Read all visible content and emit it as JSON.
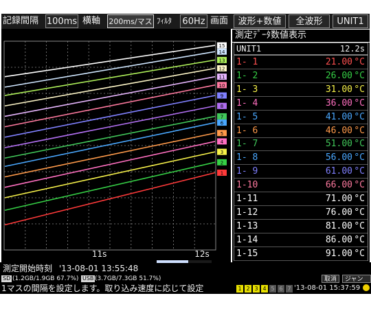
{
  "toolbar": {
    "rec_interval_label": "記録間隔",
    "rec_interval_value": "100ms",
    "horizontal_label": "横軸",
    "horizontal_value": "200ms/マス",
    "filter_label": "ﾌｨﾙﾀ",
    "filter_value": "60Hz",
    "screen_label": "画面",
    "screen_value": "波形+数値",
    "waveform_value": "全波形",
    "unit_value": "UNIT1"
  },
  "graph": {
    "x_ticks": [
      "11s",
      "12s"
    ],
    "channel_markers": [
      "15",
      "14",
      "13",
      "12",
      "11",
      "10",
      "9",
      "8",
      "7",
      "6",
      "5",
      "4",
      "3",
      "2",
      "1"
    ]
  },
  "chart_data": {
    "type": "line",
    "xlabel": "",
    "ylabel": "",
    "x_ticks": [
      "11s",
      "12s"
    ],
    "series": [
      {
        "name": "15",
        "color": "#ffffff",
        "values": [
          0.83,
          0.98
        ]
      },
      {
        "name": "14",
        "color": "#cfe6ff",
        "values": [
          0.78,
          0.95
        ]
      },
      {
        "name": "13",
        "color": "#aef05a",
        "values": [
          0.74,
          0.91
        ]
      },
      {
        "name": "12",
        "color": "#fff7c8",
        "values": [
          0.69,
          0.87
        ]
      },
      {
        "name": "11",
        "color": "#e8b6ff",
        "values": [
          0.64,
          0.83
        ]
      },
      {
        "name": "10",
        "color": "#ff7aa0",
        "values": [
          0.59,
          0.79
        ]
      },
      {
        "name": "9",
        "color": "#8080ff",
        "values": [
          0.54,
          0.74
        ]
      },
      {
        "name": "8",
        "color": "#b06ef0",
        "values": [
          0.49,
          0.69
        ]
      },
      {
        "name": "7",
        "color": "#41c85a",
        "values": [
          0.44,
          0.64
        ]
      },
      {
        "name": "6",
        "color": "#4aa8ff",
        "values": [
          0.4,
          0.61
        ]
      },
      {
        "name": "5",
        "color": "#ff9a4a",
        "values": [
          0.35,
          0.56
        ]
      },
      {
        "name": "4",
        "color": "#ff6fc0",
        "values": [
          0.3,
          0.52
        ]
      },
      {
        "name": "3",
        "color": "#f7f24a",
        "values": [
          0.25,
          0.47
        ]
      },
      {
        "name": "2",
        "color": "#36d046",
        "values": [
          0.19,
          0.42
        ]
      },
      {
        "name": "1",
        "color": "#ff3a3a",
        "values": [
          0.12,
          0.37
        ]
      }
    ]
  },
  "panel": {
    "title": "測定ﾃﾞｰﾀ数値表示",
    "unit_name": "UNIT1",
    "elapsed": "12.2s",
    "rows": [
      {
        "ch": "1- 1",
        "value": "21.00",
        "unit": "°C",
        "color": "#ff5050"
      },
      {
        "ch": "1- 2",
        "value": "26.00",
        "unit": "°C",
        "color": "#36d046"
      },
      {
        "ch": "1- 3",
        "value": "31.00",
        "unit": "°C",
        "color": "#f7f24a"
      },
      {
        "ch": "1- 4",
        "value": "36.00",
        "unit": "°C",
        "color": "#ff6fc0"
      },
      {
        "ch": "1- 5",
        "value": "41.00",
        "unit": "°C",
        "color": "#4aa8ff"
      },
      {
        "ch": "1- 6",
        "value": "46.00",
        "unit": "°C",
        "color": "#ff9a4a"
      },
      {
        "ch": "1- 7",
        "value": "51.00",
        "unit": "°C",
        "color": "#41c85a"
      },
      {
        "ch": "1- 8",
        "value": "56.00",
        "unit": "°C",
        "color": "#4aa8ff"
      },
      {
        "ch": "1- 9",
        "value": "61.00",
        "unit": "°C",
        "color": "#8080ff"
      },
      {
        "ch": "1-10",
        "value": "66.00",
        "unit": "°C",
        "color": "#ff7aa0"
      },
      {
        "ch": "1-11",
        "value": "71.00",
        "unit": "°C",
        "color": "#ffffff"
      },
      {
        "ch": "1-12",
        "value": "76.00",
        "unit": "°C",
        "color": "#ffffff"
      },
      {
        "ch": "1-13",
        "value": "81.00",
        "unit": "°C",
        "color": "#ffffff"
      },
      {
        "ch": "1-14",
        "value": "86.00",
        "unit": "°C",
        "color": "#ffffff"
      },
      {
        "ch": "1-15",
        "value": "91.00",
        "unit": "°C",
        "color": "#ffffff"
      }
    ]
  },
  "status": {
    "start_label": "測定開始時刻",
    "start_time": "'13-08-01 13:55:48",
    "sd_label": "SD",
    "sd_text": "(1.2GB/1.9GB 67.7%)",
    "usb_label": "USB",
    "usb_text": "(3.7GB/7.3GB 51.7%)",
    "cancel_label": "取消",
    "jump_label": "ジャンプ",
    "help_text": "1マスの間隔を設定します。取り込み速度に応じて設定",
    "indicators": [
      "1",
      "2",
      "3",
      "4",
      "5",
      "6",
      "7"
    ],
    "clock": "'13-08-01 15:37:59"
  },
  "colors": {
    "grid": "#8a8a8a",
    "accent_blue": "#cfe0ff"
  }
}
